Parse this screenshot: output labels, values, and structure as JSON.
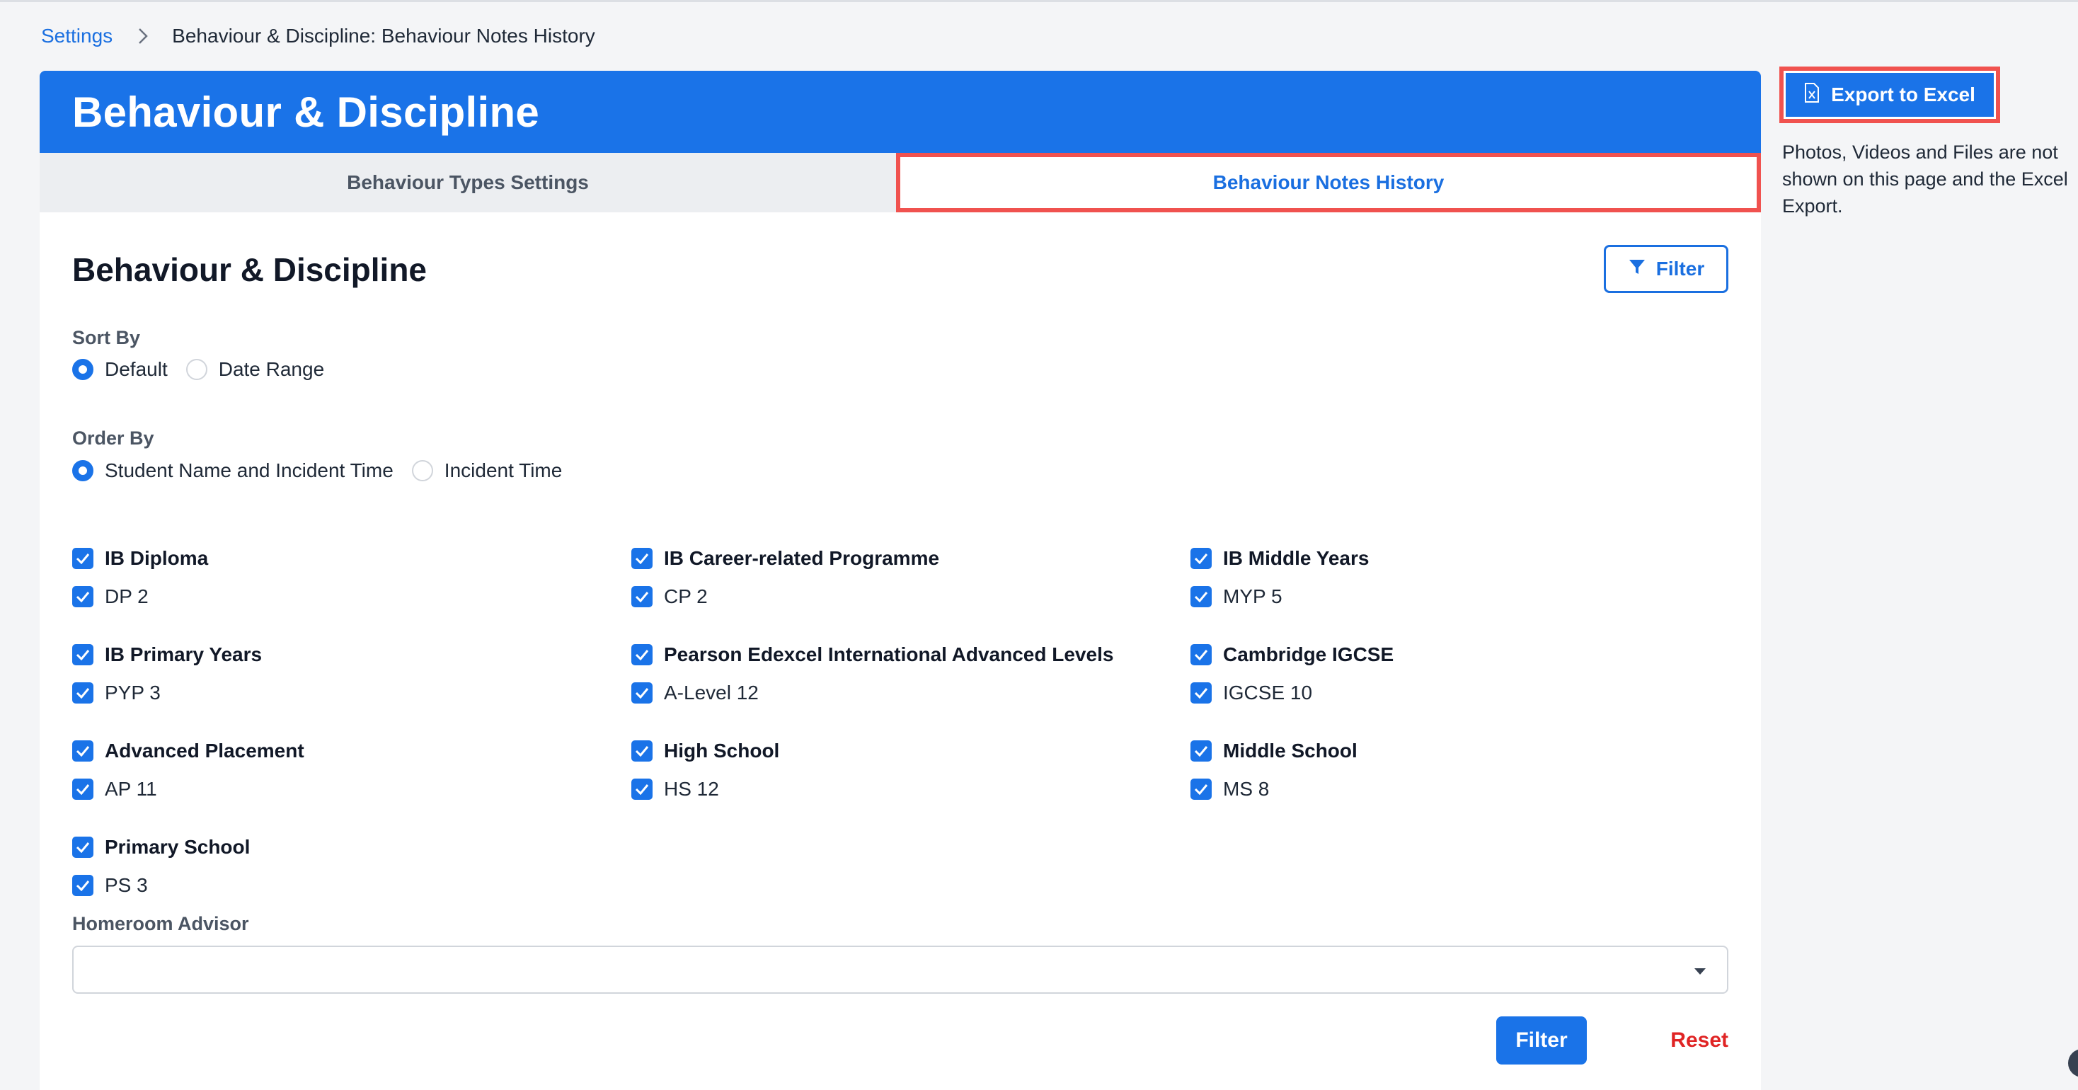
{
  "breadcrumb": {
    "parent": "Settings",
    "current": "Behaviour & Discipline: Behaviour Notes History"
  },
  "header": {
    "title": "Behaviour & Discipline"
  },
  "tabs": [
    {
      "label": "Behaviour Types Settings",
      "active": false
    },
    {
      "label": "Behaviour Notes History",
      "active": true
    }
  ],
  "main": {
    "title": "Behaviour & Discipline",
    "filter_label": "Filter",
    "sort_by": {
      "label": "Sort By",
      "options": [
        {
          "label": "Default",
          "selected": true
        },
        {
          "label": "Date Range",
          "selected": false
        }
      ]
    },
    "order_by": {
      "label": "Order By",
      "options": [
        {
          "label": "Student Name and Incident Time",
          "selected": true
        },
        {
          "label": "Incident Time",
          "selected": false
        }
      ]
    },
    "programmes": [
      {
        "name": "IB Diploma",
        "grade": "DP 2"
      },
      {
        "name": "IB Career-related Programme",
        "grade": "CP 2"
      },
      {
        "name": "IB Middle Years",
        "grade": "MYP 5"
      },
      {
        "name": "IB Primary Years",
        "grade": "PYP 3"
      },
      {
        "name": "Pearson Edexcel International Advanced Levels",
        "grade": "A-Level 12"
      },
      {
        "name": "Cambridge IGCSE",
        "grade": "IGCSE 10"
      },
      {
        "name": "Advanced Placement",
        "grade": "AP 11"
      },
      {
        "name": "High School",
        "grade": "HS 12"
      },
      {
        "name": "Middle School",
        "grade": "MS 8"
      },
      {
        "name": "Primary School",
        "grade": "PS 3"
      }
    ],
    "homeroom_advisor": {
      "label": "Homeroom Advisor",
      "value": ""
    },
    "filter_button": "Filter",
    "reset_button": "Reset"
  },
  "sidebar": {
    "export_label": "Export to Excel",
    "note": "Photos, Videos and Files are not shown on this page and the Excel Export."
  },
  "colors": {
    "primary": "#1a73e8",
    "highlight": "#f0524f",
    "danger": "#e02424"
  }
}
